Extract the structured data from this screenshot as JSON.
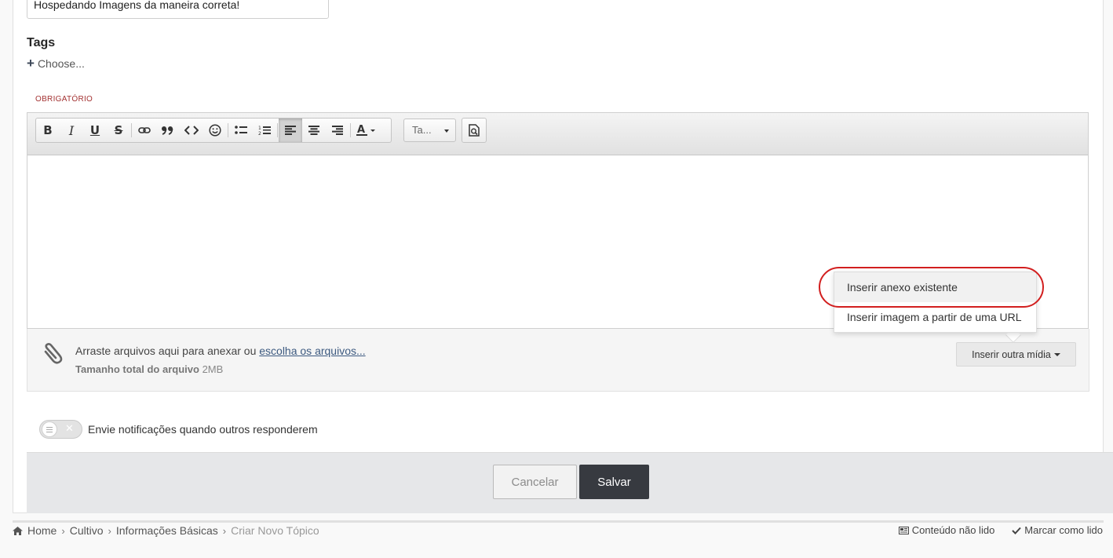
{
  "form": {
    "title_value": "Hospedando Imagens da maneira correta!",
    "tags_label": "Tags",
    "tags_choose": "Choose...",
    "required_label": "OBRIGATÓRIO"
  },
  "editor": {
    "toolbar": {
      "bold": "B",
      "italic": "I",
      "underline": "U",
      "strike": "S",
      "font_size_value": "Ta...",
      "active_alignment": "align-left"
    }
  },
  "attachments": {
    "drop_text": "Arraste arquivos aqui para anexar ou",
    "choose_link": "escolha os arquivos...",
    "size_label": "Tamanho total do arquivo",
    "size_value": "2MB",
    "insert_media_button": "Inserir outra mídia"
  },
  "media_menu": {
    "items": [
      {
        "label": "Inserir anexo existente"
      },
      {
        "label": "Inserir imagem a partir de uma URL"
      }
    ],
    "highlight_color": "#d21f1f"
  },
  "notify": {
    "label": "Envie notificações quando outros responderem",
    "enabled": false
  },
  "actions": {
    "cancel": "Cancelar",
    "save": "Salvar"
  },
  "breadcrumb": {
    "items": [
      "Home",
      "Cultivo",
      "Informações Básicas"
    ],
    "current": "Criar Novo Tópico"
  },
  "footer_links": {
    "unread": "Conteúdo não lido",
    "mark_read": "Marcar como lido"
  }
}
